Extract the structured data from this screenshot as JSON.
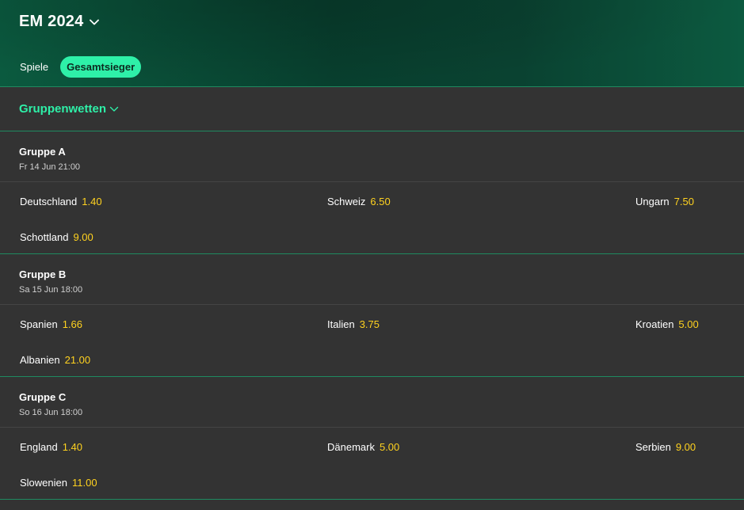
{
  "header": {
    "title": "EM 2024",
    "tabs": [
      {
        "label": "Spiele",
        "active": false
      },
      {
        "label": "Gesamtsieger",
        "active": true
      }
    ]
  },
  "section": {
    "title": "Gruppenwetten"
  },
  "groups": [
    {
      "name": "Gruppe A",
      "date": "Fr 14 Jun 21:00",
      "odds": [
        {
          "team": "Deutschland",
          "price": "1.40"
        },
        {
          "team": "Schweiz",
          "price": "6.50"
        },
        {
          "team": "Ungarn",
          "price": "7.50"
        },
        {
          "team": "Schottland",
          "price": "9.00"
        }
      ]
    },
    {
      "name": "Gruppe B",
      "date": "Sa 15 Jun 18:00",
      "odds": [
        {
          "team": "Spanien",
          "price": "1.66"
        },
        {
          "team": "Italien",
          "price": "3.75"
        },
        {
          "team": "Kroatien",
          "price": "5.00"
        },
        {
          "team": "Albanien",
          "price": "21.00"
        }
      ]
    },
    {
      "name": "Gruppe C",
      "date": "So 16 Jun 18:00",
      "odds": [
        {
          "team": "England",
          "price": "1.40"
        },
        {
          "team": "Dänemark",
          "price": "5.00"
        },
        {
          "team": "Serbien",
          "price": "9.00"
        },
        {
          "team": "Slowenien",
          "price": "11.00"
        }
      ]
    }
  ],
  "colors": {
    "accent": "#2ef0a8",
    "price": "#ffd21f",
    "background": "#333333",
    "divider": "#1f8a60"
  },
  "icons": {
    "title_chevron": "chevron-down-icon",
    "section_chevron": "chevron-down-icon"
  }
}
